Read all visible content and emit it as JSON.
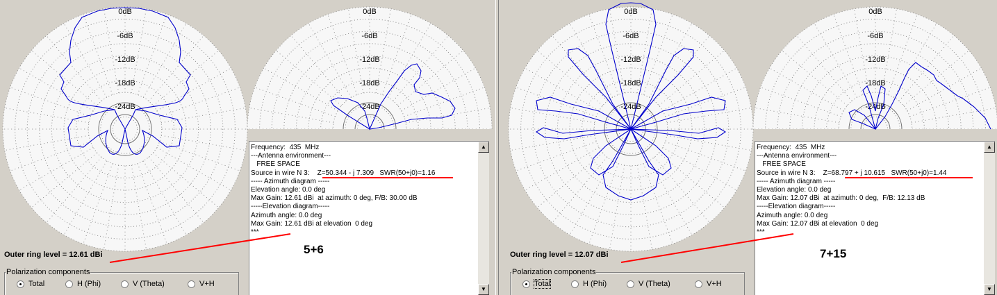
{
  "ring_labels": [
    "0dB",
    "-6dB",
    "-12dB",
    "-18dB",
    "-24dB"
  ],
  "colors": {
    "pattern": "#0000cc",
    "annotation": "#ff0000",
    "grid_dot": "#8c8c8c",
    "plot_bg": "#f7f7f7"
  },
  "panels": [
    {
      "info_lines": [
        "Frequency:  435  MHz",
        "---Antenna environment---",
        "   FREE SPACE",
        "Source in wire N 3:    Z=50.344 - j 7.309   SWR(50+j0)=1.16",
        "----- Azimuth diagram -----",
        "Elevation angle: 0.0 deg",
        "Max Gain: 12.61 dBi  at azimuth: 0 deg, F/B: 30.00 dB",
        "-----Elevation diagram-----",
        "Azimuth angle: 0.0 deg",
        "Max Gain: 12.61 dBi at elevation  0 deg",
        "***"
      ],
      "outer_ring": "Outer ring level = 12.61 dBi",
      "big_label": "5+6",
      "polarization": {
        "title": "Polarization components",
        "options": [
          "Total",
          "H (Phi)",
          "V (Theta)",
          "V+H"
        ],
        "selected": "Total"
      }
    },
    {
      "info_lines": [
        "Frequency:  435  MHz",
        "---Antenna environment---",
        "   FREE SPACE",
        "Source in wire N 3:    Z=68.797 + j 10.615   SWR(50+j0)=1.44",
        "----- Azimuth diagram -----",
        "Elevation angle: 0.0 deg",
        "Max Gain: 12.07 dBi  at azimuth: 0 deg,  F/B: 12.13 dB",
        "-----Elevation diagram-----",
        "Azimuth angle: 0.0 deg",
        "Max Gain: 12.07 dBi at elevation  0 deg",
        "***"
      ],
      "outer_ring": "Outer ring level = 12.07 dBi",
      "big_label": "7+15",
      "polarization": {
        "title": "Polarization components",
        "options": [
          "Total",
          "H (Phi)",
          "V (Theta)",
          "V+H"
        ],
        "selected": "Total"
      }
    }
  ]
}
